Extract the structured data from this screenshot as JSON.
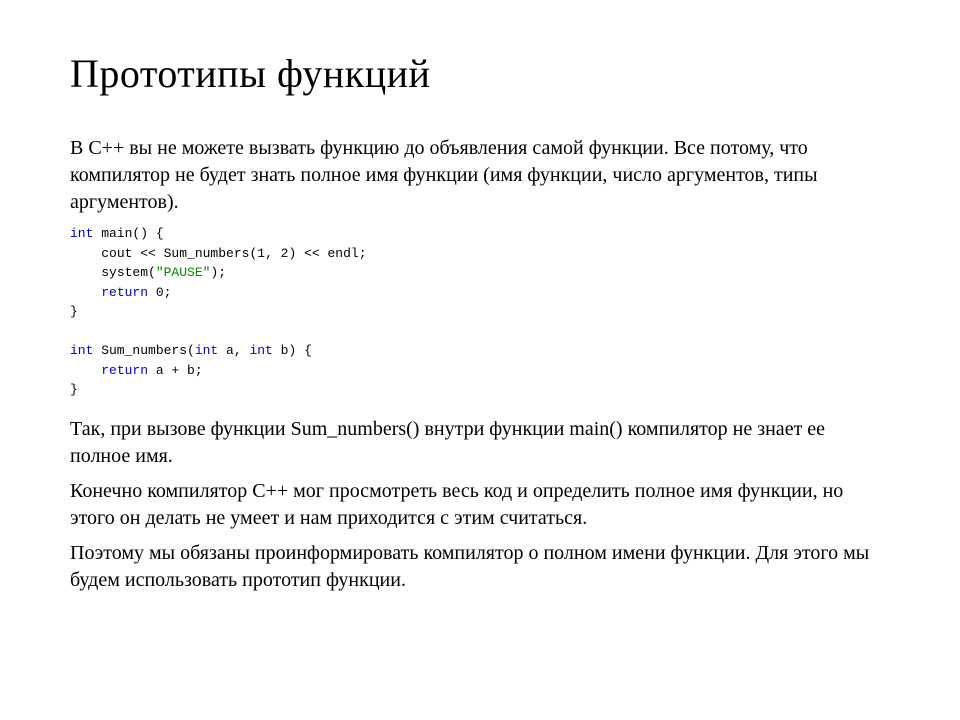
{
  "title": "Прототипы функций",
  "para1": "В C++ вы не можете вызвать функцию до объявления самой функции. Все потому, что компилятор не будет знать полное имя функции (имя функции, число аргументов, типы аргументов).",
  "code": {
    "l1_kw": "int",
    "l1_rest": " main() {",
    "l2_indent": "    ",
    "l2_a": "cout << Sum_numbers(",
    "l2_n1": "1",
    "l2_b": ", ",
    "l2_n2": "2",
    "l2_c": ") << endl;",
    "l3_indent": "    ",
    "l3_a": "system(",
    "l3_str": "\"PAUSE\"",
    "l3_b": ");",
    "l4_indent": "    ",
    "l4_kw": "return",
    "l4_rest": " ",
    "l4_n": "0",
    "l4_end": ";",
    "l5": "}",
    "blank": "",
    "l6_kw": "int",
    "l6_a": " Sum_numbers(",
    "l6_kw2": "int",
    "l6_b": " a, ",
    "l6_kw3": "int",
    "l6_c": " b) {",
    "l7_indent": "    ",
    "l7_kw": "return",
    "l7_rest": " a + b;",
    "l8": "}"
  },
  "para2": "Так, при вызове функции Sum_numbers() внутри функции main() компилятор не знает ее полное имя.",
  "para3": "Конечно компилятор C++ мог просмотреть весь код и определить полное имя функции, но этого он делать не умеет и нам приходится с этим считаться.",
  "para4": "Поэтому мы обязаны проинформировать компилятор о полном имени функции. Для этого мы будем использовать прототип функции."
}
